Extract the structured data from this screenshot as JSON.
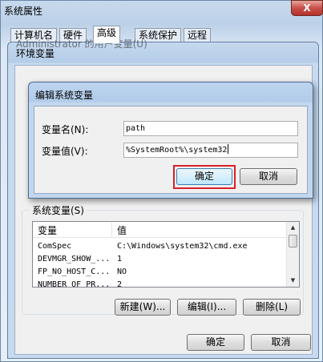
{
  "sysprops": {
    "title": "系统属性",
    "close_label": "X",
    "tabs": [
      {
        "label": "计算机名"
      },
      {
        "label": "硬件"
      },
      {
        "label": "高级"
      },
      {
        "label": "系统保护"
      },
      {
        "label": "远程"
      }
    ],
    "active_tab": "高级",
    "ok_label": "确定",
    "cancel_label": "取消"
  },
  "env": {
    "title": "环境变量",
    "user_group_label": "Administrator 的用户变量(U)",
    "system_group_label": "系统变量(S)",
    "columns": [
      "变量",
      "值"
    ],
    "rows": [
      {
        "name": "ComSpec",
        "value": "C:\\Windows\\system32\\cmd.exe"
      },
      {
        "name": "DEVMGR_SHOW_...",
        "value": "1"
      },
      {
        "name": "FP_NO_HOST_C...",
        "value": "NO"
      },
      {
        "name": "NUMBER_OF_PR...",
        "value": "2"
      }
    ],
    "new_button": "新建(W)...",
    "edit_button": "编辑(I)...",
    "delete_button": "删除(L)"
  },
  "edit_dialog": {
    "title": "编辑系统变量",
    "name_label": "变量名(N):",
    "name_value": "path",
    "value_label": "变量值(V):",
    "value_value": "%SystemRoot%\\system32",
    "ok_label": "确定",
    "cancel_label": "取消",
    "highlight_color": "#d9202a"
  }
}
